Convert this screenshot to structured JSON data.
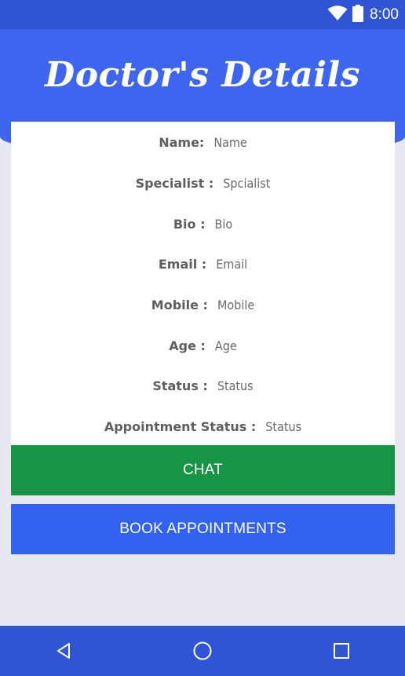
{
  "status_bar": {
    "time": "8:00",
    "icons": [
      "wifi-icon",
      "battery-icon"
    ]
  },
  "header": {
    "title": "Doctor's Details"
  },
  "details": [
    {
      "label": "Name:",
      "value": "Name"
    },
    {
      "label": "Specialist :",
      "value": "Spcialist"
    },
    {
      "label": "Bio :",
      "value": "Bio"
    },
    {
      "label": "Email :",
      "value": "Email"
    },
    {
      "label": "Mobile :",
      "value": "Mobile"
    },
    {
      "label": "Age :",
      "value": "Age"
    },
    {
      "label": "Status :",
      "value": "Status"
    },
    {
      "label": "Appointment Status :",
      "value": "Status"
    }
  ],
  "buttons": {
    "chat": "CHAT",
    "book": "BOOK APPOINTMENTS"
  },
  "nav_bar": {
    "icons": [
      "back-icon",
      "home-icon",
      "recents-icon"
    ]
  },
  "colors": {
    "header": "#3e65f0",
    "status_bar": "#2f55d4",
    "chat_button": "#189447",
    "book_button": "#3362ee",
    "background": "#e8e8f2"
  }
}
